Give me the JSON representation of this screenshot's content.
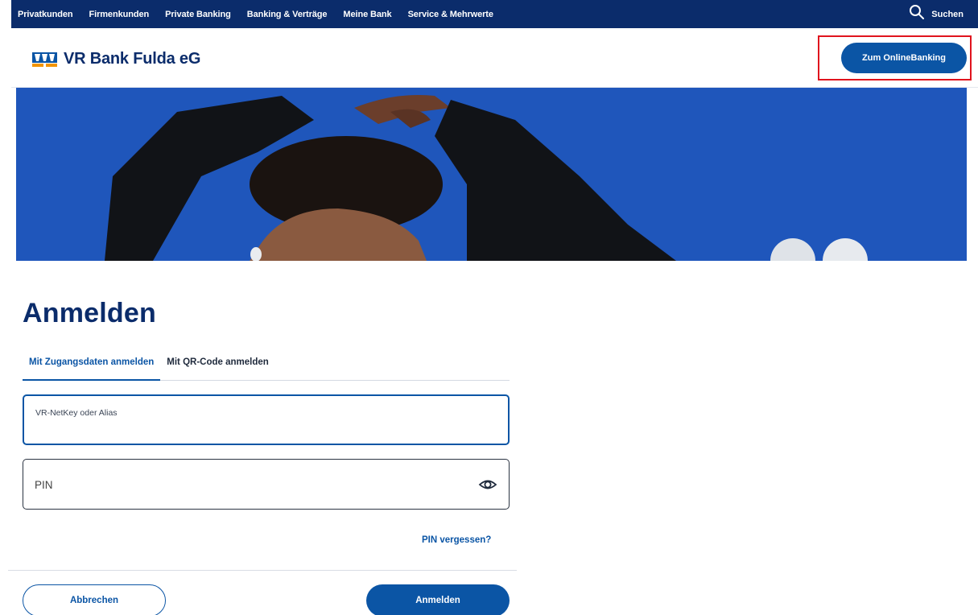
{
  "topnav": {
    "items": [
      "Privatkunden",
      "Firmenkunden",
      "Private Banking",
      "Banking & Verträge",
      "Meine Bank",
      "Service & Mehrwerte"
    ],
    "search_label": "Suchen",
    "search_icon": "search-icon"
  },
  "header": {
    "logo_text": "VR Bank Fulda eG",
    "online_banking_button": "Zum OnlineBanking"
  },
  "colors": {
    "nav_bg": "#0b2c6b",
    "primary": "#0b55a5",
    "hero_bg": "#1e54b8",
    "highlight": "#e0141e",
    "logo_orange": "#f29400"
  },
  "login": {
    "title": "Anmelden",
    "tabs": [
      {
        "label": "Mit Zugangsdaten anmelden",
        "active": true
      },
      {
        "label": "Mit QR-Code anmelden",
        "active": false
      }
    ],
    "username": {
      "label": "VR-NetKey oder Alias",
      "value": ""
    },
    "pin": {
      "placeholder": "PIN",
      "value": "",
      "toggle_icon": "eye-icon"
    },
    "forgot_link": "PIN vergessen?",
    "cancel_button": "Abbrechen",
    "submit_button": "Anmelden"
  }
}
